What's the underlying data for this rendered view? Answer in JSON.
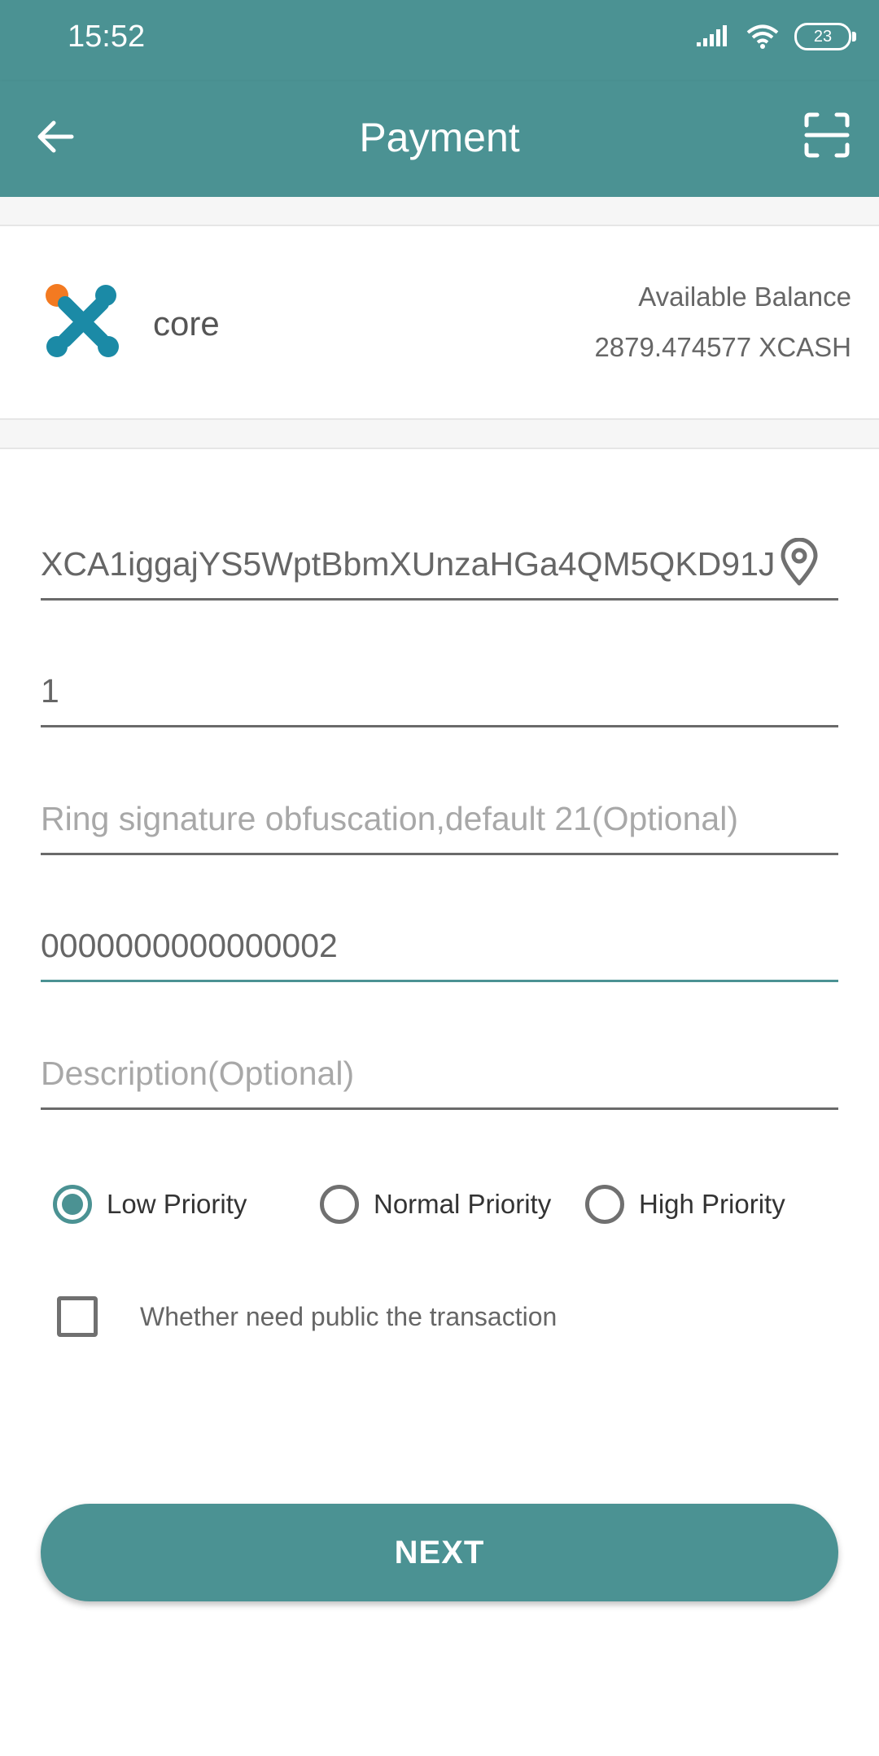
{
  "status_bar": {
    "time": "15:52",
    "battery": "23",
    "icons": [
      "signal-icon",
      "wifi-icon",
      "battery-icon"
    ]
  },
  "toolbar": {
    "title": "Payment",
    "back_icon": "arrow-left-icon",
    "scan_icon": "scan-icon"
  },
  "wallet": {
    "name": "core",
    "balance_label": "Available Balance",
    "balance_value": "2879.474577 XCASH"
  },
  "form": {
    "address": {
      "value": "XCA1iggajYS5WptBbmXUnzaHGa4QM5QKD91J",
      "placeholder": ""
    },
    "amount": {
      "value": "1",
      "placeholder": ""
    },
    "ring_size": {
      "value": "",
      "placeholder": "Ring signature obfuscation,default 21(Optional)"
    },
    "payment_id": {
      "value": "0000000000000002",
      "placeholder": ""
    },
    "description": {
      "value": "",
      "placeholder": "Description(Optional)"
    }
  },
  "priority": {
    "options": [
      "Low Priority",
      "Normal Priority",
      "High Priority"
    ],
    "selected": "Low Priority"
  },
  "public_tx": {
    "label": "Whether need public the transaction",
    "checked": false
  },
  "next_label": "NEXT",
  "colors": {
    "accent": "#4b9293",
    "logo_orange": "#f37a21",
    "logo_blue": "#1b8aa6"
  }
}
